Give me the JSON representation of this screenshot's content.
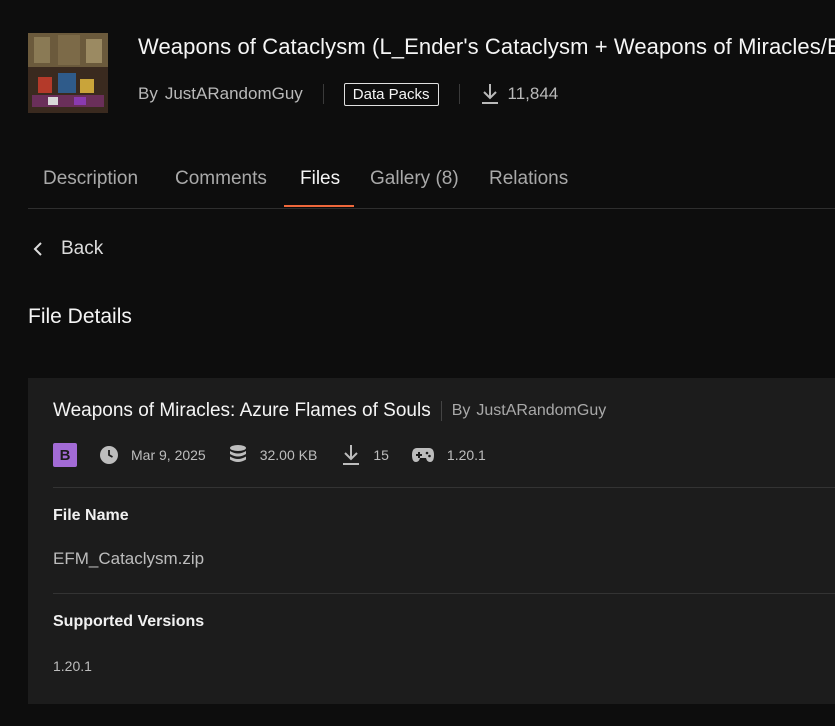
{
  "project": {
    "title": "Weapons of Cataclysm (L_Ender's Cataclysm + Weapons of Miracles/Ep",
    "by_label": "By",
    "author": "JustARandomGuy",
    "category": "Data Packs",
    "downloads": "11,844",
    "thumbnail_icon": "mod-thumbnail"
  },
  "tabs": [
    {
      "label": "Description",
      "active": false
    },
    {
      "label": "Comments",
      "active": false
    },
    {
      "label": "Files",
      "active": true
    },
    {
      "label": "Gallery (8)",
      "active": false
    },
    {
      "label": "Relations",
      "active": false
    }
  ],
  "back_label": "Back",
  "section_title": "File Details",
  "file": {
    "title": "Weapons of Miracles: Azure Flames of Souls",
    "by_label": "By",
    "author": "JustARandomGuy",
    "release_type": "B",
    "date": "Mar 9, 2025",
    "size": "32.00 KB",
    "downloads": "15",
    "game_version": "1.20.1",
    "file_name_label": "File Name",
    "file_name": "EFM_Cataclysm.zip",
    "supported_versions_label": "Supported Versions",
    "supported_versions": "1.20.1"
  },
  "colors": {
    "background": "#0d0d0d",
    "card": "#1c1c1c",
    "accent": "#f0683b",
    "beta_badge": "#a36bd6"
  }
}
